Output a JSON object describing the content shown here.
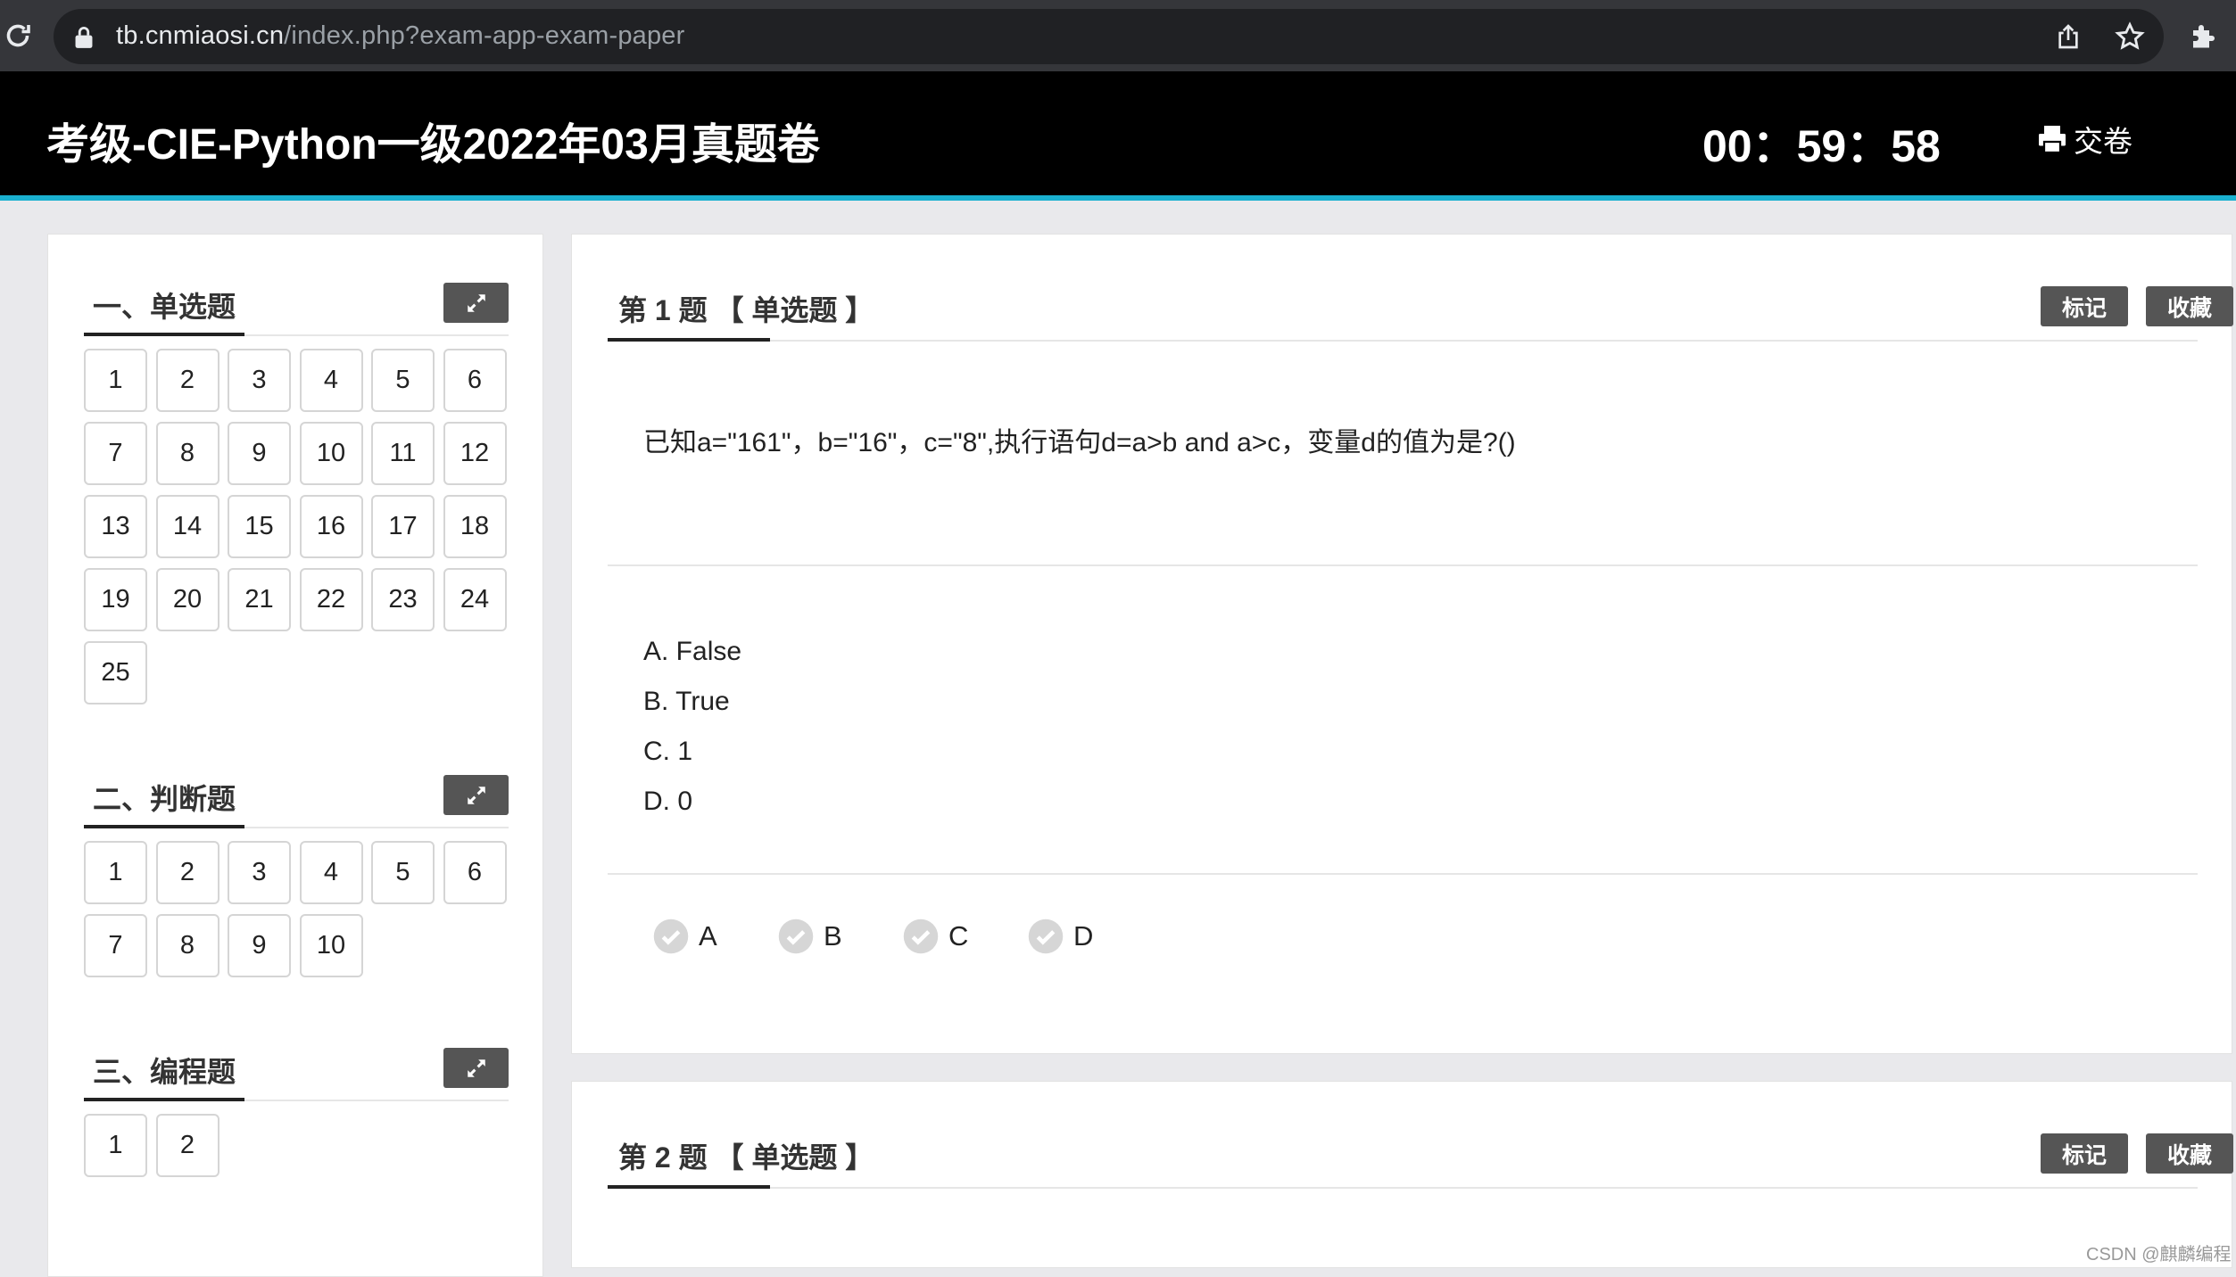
{
  "browser": {
    "url_domain": "tb.cnmiaosi.cn",
    "url_path": "/index.php?exam-app-exam-paper"
  },
  "exam": {
    "title": "考级-CIE-Python一级2022年03月真题卷",
    "timer": "00：59：58",
    "submit_label": "交卷"
  },
  "sidebar": {
    "sections": [
      {
        "title": "一、单选题",
        "items": [
          "1",
          "2",
          "3",
          "4",
          "5",
          "6",
          "7",
          "8",
          "9",
          "10",
          "11",
          "12",
          "13",
          "14",
          "15",
          "16",
          "17",
          "18",
          "19",
          "20",
          "21",
          "22",
          "23",
          "24",
          "25"
        ]
      },
      {
        "title": "二、判断题",
        "items": [
          "1",
          "2",
          "3",
          "4",
          "5",
          "6",
          "7",
          "8",
          "9",
          "10"
        ]
      },
      {
        "title": "三、编程题",
        "items": [
          "1",
          "2"
        ]
      }
    ]
  },
  "questions": [
    {
      "title": "第 1 题 【 单选题 】",
      "mark_label": "标记",
      "fav_label": "收藏",
      "text": "已知a=\"161\"，b=\"16\"，c=\"8\",执行语句d=a>b and a>c，变量d的值为是?()",
      "options": [
        "A. False",
        "B. True",
        "C. 1",
        "D. 0"
      ],
      "answers": [
        "A",
        "B",
        "C",
        "D"
      ]
    },
    {
      "title": "第 2 题 【 单选题 】",
      "mark_label": "标记",
      "fav_label": "收藏"
    }
  ],
  "watermark": "CSDN @麒麟编程",
  "colors": {
    "header_bg": "#000000",
    "header_accent": "#1ab0cf",
    "button_gray": "#555555"
  }
}
